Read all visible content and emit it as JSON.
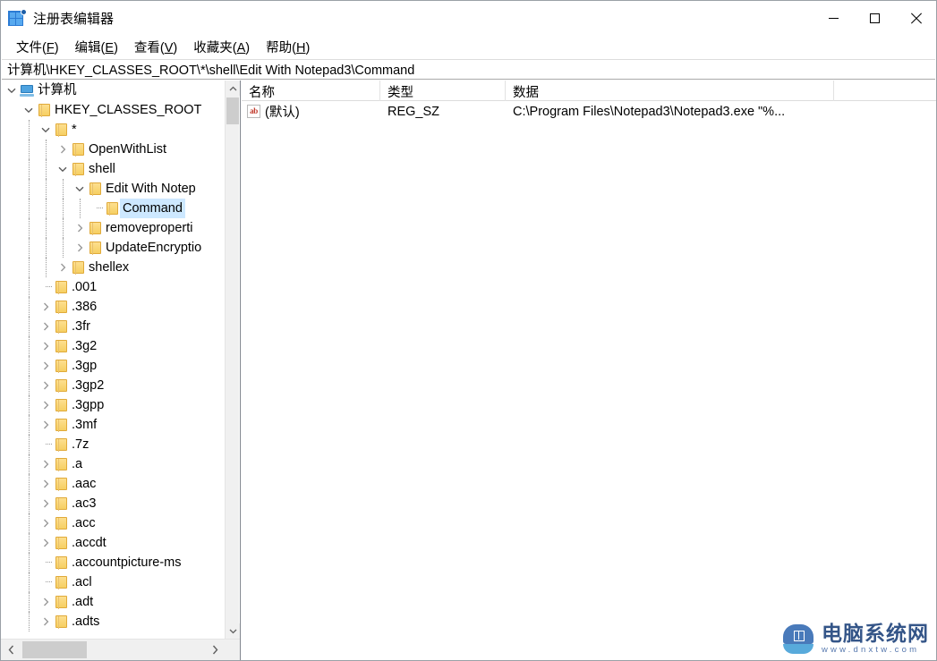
{
  "window": {
    "title": "注册表编辑器",
    "icon": "registry-editor-icon",
    "minimize_label": "最小化",
    "maximize_label": "最大化",
    "close_label": "关闭"
  },
  "menubar": {
    "items": [
      {
        "label": "文件",
        "accel": "F"
      },
      {
        "label": "编辑",
        "accel": "E"
      },
      {
        "label": "查看",
        "accel": "V"
      },
      {
        "label": "收藏夹",
        "accel": "A"
      },
      {
        "label": "帮助",
        "accel": "H"
      }
    ]
  },
  "address": {
    "path": "计算机\\HKEY_CLASSES_ROOT\\*\\shell\\Edit With Notepad3\\Command"
  },
  "tree": {
    "items": [
      {
        "label": "计算机",
        "depth": 0,
        "arrow": "down",
        "icon": "computer-icon",
        "selected": false
      },
      {
        "label": "HKEY_CLASSES_ROOT",
        "depth": 1,
        "arrow": "down",
        "icon": "folder-icon",
        "selected": false
      },
      {
        "label": "*",
        "depth": 2,
        "arrow": "down",
        "icon": "folder-icon",
        "selected": false
      },
      {
        "label": "OpenWithList",
        "depth": 3,
        "arrow": "right",
        "icon": "folder-icon",
        "selected": false
      },
      {
        "label": "shell",
        "depth": 3,
        "arrow": "down",
        "icon": "folder-icon",
        "selected": false
      },
      {
        "label": "Edit With Notep",
        "depth": 4,
        "arrow": "down",
        "icon": "folder-icon",
        "selected": false
      },
      {
        "label": "Command",
        "depth": 5,
        "arrow": "none",
        "icon": "folder-icon",
        "selected": true
      },
      {
        "label": "removeproperti",
        "depth": 4,
        "arrow": "right",
        "icon": "folder-icon",
        "selected": false
      },
      {
        "label": "UpdateEncryptio",
        "depth": 4,
        "arrow": "right",
        "icon": "folder-icon",
        "selected": false
      },
      {
        "label": "shellex",
        "depth": 3,
        "arrow": "right",
        "icon": "folder-icon",
        "selected": false
      },
      {
        "label": ".001",
        "depth": 2,
        "arrow": "none",
        "icon": "folder-icon",
        "selected": false
      },
      {
        "label": ".386",
        "depth": 2,
        "arrow": "right",
        "icon": "folder-icon",
        "selected": false
      },
      {
        "label": ".3fr",
        "depth": 2,
        "arrow": "right",
        "icon": "folder-icon",
        "selected": false
      },
      {
        "label": ".3g2",
        "depth": 2,
        "arrow": "right",
        "icon": "folder-icon",
        "selected": false
      },
      {
        "label": ".3gp",
        "depth": 2,
        "arrow": "right",
        "icon": "folder-icon",
        "selected": false
      },
      {
        "label": ".3gp2",
        "depth": 2,
        "arrow": "right",
        "icon": "folder-icon",
        "selected": false
      },
      {
        "label": ".3gpp",
        "depth": 2,
        "arrow": "right",
        "icon": "folder-icon",
        "selected": false
      },
      {
        "label": ".3mf",
        "depth": 2,
        "arrow": "right",
        "icon": "folder-icon",
        "selected": false
      },
      {
        "label": ".7z",
        "depth": 2,
        "arrow": "none",
        "icon": "folder-icon",
        "selected": false
      },
      {
        "label": ".a",
        "depth": 2,
        "arrow": "right",
        "icon": "folder-icon",
        "selected": false
      },
      {
        "label": ".aac",
        "depth": 2,
        "arrow": "right",
        "icon": "folder-icon",
        "selected": false
      },
      {
        "label": ".ac3",
        "depth": 2,
        "arrow": "right",
        "icon": "folder-icon",
        "selected": false
      },
      {
        "label": ".acc",
        "depth": 2,
        "arrow": "right",
        "icon": "folder-icon",
        "selected": false
      },
      {
        "label": ".accdt",
        "depth": 2,
        "arrow": "right",
        "icon": "folder-icon",
        "selected": false
      },
      {
        "label": ".accountpicture-ms",
        "depth": 2,
        "arrow": "none",
        "icon": "folder-icon",
        "selected": false
      },
      {
        "label": ".acl",
        "depth": 2,
        "arrow": "none",
        "icon": "folder-icon",
        "selected": false
      },
      {
        "label": ".adt",
        "depth": 2,
        "arrow": "right",
        "icon": "folder-icon",
        "selected": false
      },
      {
        "label": ".adts",
        "depth": 2,
        "arrow": "right",
        "icon": "folder-icon",
        "selected": false
      }
    ]
  },
  "list": {
    "columns": [
      "名称",
      "类型",
      "数据"
    ],
    "rows": [
      {
        "icon": "string-value-icon",
        "name": "(默认)",
        "type": "REG_SZ",
        "data": "C:\\Program Files\\Notepad3\\Notepad3.exe \"%..."
      }
    ]
  },
  "watermark": {
    "name": "电脑系统网",
    "url": "www.dnxtw.com"
  },
  "colors": {
    "selection": "#cde8ff",
    "folder": "#f6cf62",
    "titlebar": "#ffffff",
    "accent": "#2b7bd4"
  }
}
